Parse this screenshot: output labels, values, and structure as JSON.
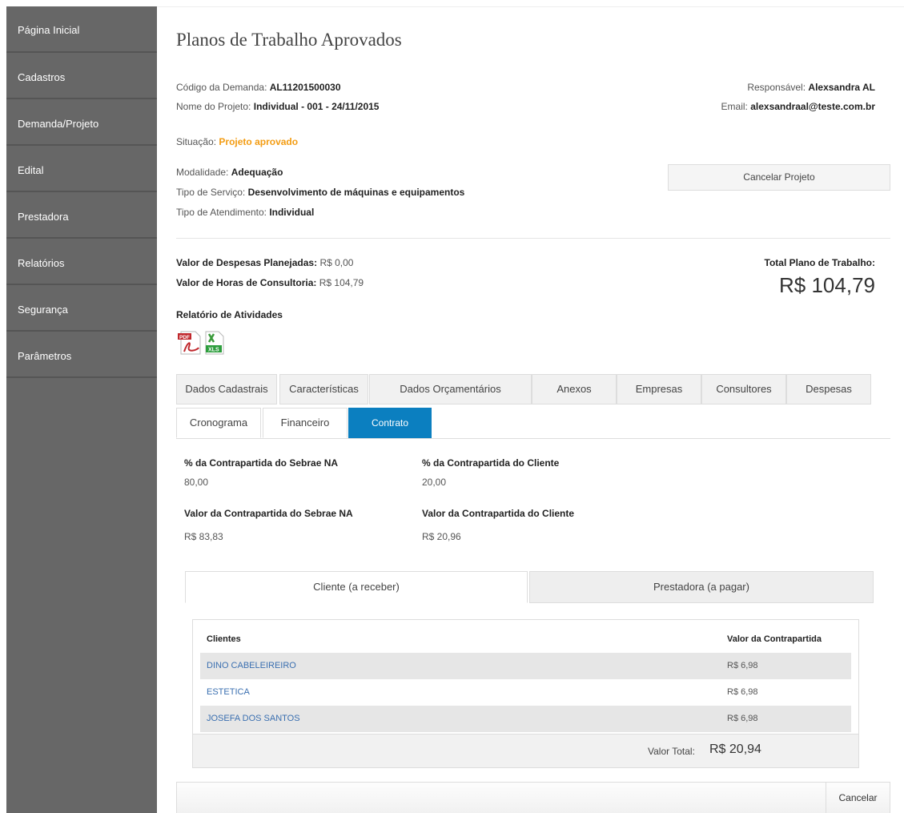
{
  "sidebar": {
    "items": [
      {
        "label": "Página Inicial"
      },
      {
        "label": "Cadastros"
      },
      {
        "label": "Demanda/Projeto"
      },
      {
        "label": "Edital"
      },
      {
        "label": "Prestadora"
      },
      {
        "label": "Relatórios"
      },
      {
        "label": "Segurança"
      },
      {
        "label": "Parâmetros"
      }
    ]
  },
  "page": {
    "title": "Planos de Trabalho Aprovados"
  },
  "project": {
    "codigo_label": "Código da Demanda:",
    "codigo": "AL11201500030",
    "nome_label": "Nome do Projeto:",
    "nome": "Individual - 001 - 24/11/2015",
    "responsavel_label": "Responsável:",
    "responsavel": "Alexsandra AL",
    "email_label": "Email:",
    "email": "alexsandraal@teste.com.br",
    "situacao_label": "Situação:",
    "situacao": "Projeto aprovado",
    "modalidade_label": "Modalidade:",
    "modalidade": "Adequação",
    "servico_label": "Tipo de Serviço:",
    "servico": "Desenvolvimento de máquinas e equipamentos",
    "atendimento_label": "Tipo de Atendimento:",
    "atendimento": "Individual",
    "cancel_project_label": "Cancelar Projeto"
  },
  "values": {
    "despesas_label": "Valor de Despesas Planejadas:",
    "despesas": "R$ 0,00",
    "horas_label": "Valor de Horas de Consultoria:",
    "horas": "R$ 104,79",
    "total_label": "Total Plano de Trabalho:",
    "total": "R$ 104,79",
    "relatorio_label": "Relatório de Atividades",
    "pdf_icon_text": "PDF",
    "xls_icon_text": "XLS"
  },
  "tabs": [
    {
      "label": "Dados Cadastrais"
    },
    {
      "label": "Características"
    },
    {
      "label": "Dados Orçamentários"
    },
    {
      "label": "Anexos"
    },
    {
      "label": "Empresas"
    },
    {
      "label": "Consultores"
    },
    {
      "label": "Despesas"
    },
    {
      "label": "Cronograma"
    },
    {
      "label": "Financeiro"
    },
    {
      "label": "Contrato"
    }
  ],
  "financeiro": {
    "pct_sebrae_label": "% da Contrapartida do Sebrae NA",
    "pct_sebrae": "80,00",
    "pct_cliente_label": "% da Contrapartida do Cliente",
    "pct_cliente": "20,00",
    "val_sebrae_label": "Valor da Contrapartida do Sebrae NA",
    "val_sebrae": "R$ 83,83",
    "val_cliente_label": "Valor da Contrapartida do Cliente",
    "val_cliente": "R$ 20,96"
  },
  "subtabs": [
    {
      "label": "Cliente (a receber)"
    },
    {
      "label": "Prestadora (a pagar)"
    }
  ],
  "table": {
    "headers": [
      "Clientes",
      "Valor da Contrapartida"
    ],
    "rows": [
      {
        "cliente": "DINO CABELEIREIRO",
        "valor": "R$ 6,98"
      },
      {
        "cliente": "ESTETICA",
        "valor": "R$ 6,98"
      },
      {
        "cliente": "JOSEFA DOS SANTOS",
        "valor": "R$ 6,98"
      }
    ],
    "total_label": "Valor Total:",
    "total": "R$ 20,94"
  },
  "footer": {
    "cancel_label": "Cancelar"
  }
}
